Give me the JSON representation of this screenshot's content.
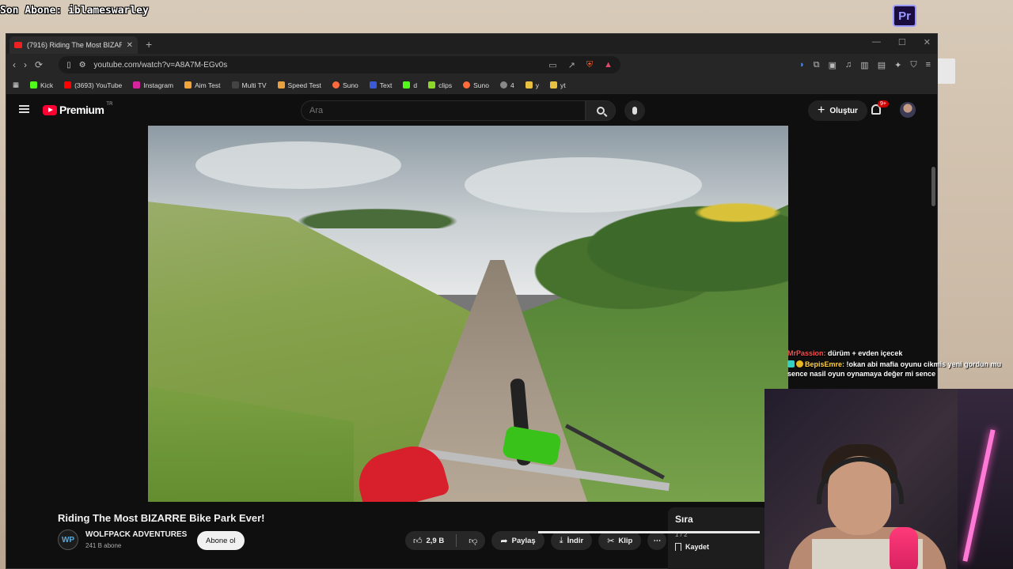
{
  "overlay": {
    "subscriber_text": "Son Abone: iblameswarley"
  },
  "desktop": {
    "premiere_icon_label": "Pr"
  },
  "browser": {
    "tab_title": "(7916) Riding The Most BIZARRE",
    "new_tab": "+",
    "url": "youtube.com/watch?v=A8A7M-EGv0s",
    "bookmarks": [
      "Kick",
      "(3693) YouTube",
      "Instagram",
      "Aim Test",
      "Multi TV",
      "Speed Test",
      "Suno",
      "Text",
      "d",
      "clips",
      "Suno",
      "4",
      "y",
      "yt"
    ]
  },
  "youtube": {
    "logo_word": "Premium",
    "logo_region": "TR",
    "search_placeholder": "Ara",
    "create_label": "Oluştur",
    "notif_badge": "9+"
  },
  "video": {
    "title": "Riding The Most BIZARRE Bike Park Ever!",
    "channel_name": "WOLFPACK ADVENTURES",
    "channel_initials": "WP",
    "subscribers": "241 B abone",
    "subscribe_label": "Abone ol",
    "likes": "2,9 B",
    "share_label": "Paylaş",
    "download_label": "İndir",
    "clip_label": "Klip",
    "more_label": "⋯"
  },
  "queue": {
    "title": "Sıra",
    "count": "1 / 2",
    "save_label": "Kaydet"
  },
  "chat": [
    {
      "user": "MrPassion:",
      "message": "dürüm + evden içecek"
    },
    {
      "user": "BepisEmre:",
      "message": "!okan abi mafia oyunu cikmis yeni gordun mu sence nasil oyun oynamaya değer mi sence"
    }
  ],
  "colors": {
    "youtube_red": "#ff0033",
    "chat_user1": "#ff4d4d",
    "chat_user2": "#ffd24d"
  }
}
